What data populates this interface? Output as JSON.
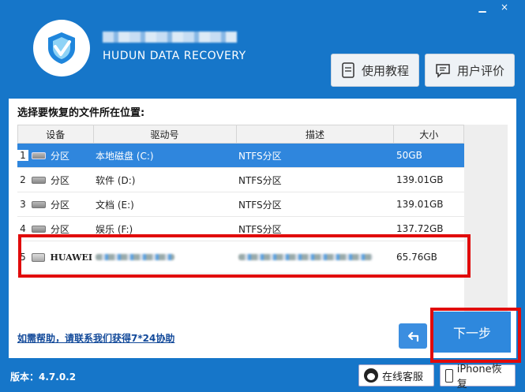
{
  "window": {
    "minimize_icon": "minimize-icon",
    "close_label": "×"
  },
  "brand": {
    "name": "HUDUN DATA RECOVERY"
  },
  "header_buttons": [
    {
      "label": "使用教程",
      "icon": "book-icon"
    },
    {
      "label": "用户评价",
      "icon": "comment-icon"
    }
  ],
  "panel": {
    "title": "选择要恢复的文件所在位置:"
  },
  "table": {
    "columns": [
      "设备",
      "驱动号",
      "描述",
      "大小"
    ],
    "rows": [
      {
        "num": "1",
        "device": "分区",
        "drive": "本地磁盘 (C:)",
        "desc": "NTFS分区",
        "size": "50GB",
        "selected": true
      },
      {
        "num": "2",
        "device": "分区",
        "drive": "软件 (D:)",
        "desc": "NTFS分区",
        "size": "139.01GB"
      },
      {
        "num": "3",
        "device": "分区",
        "drive": "文档 (E:)",
        "desc": "NTFS分区",
        "size": "139.01GB"
      },
      {
        "num": "4",
        "device": "分区",
        "drive": "娱乐 (F:)",
        "desc": "NTFS分区",
        "size": "137.72GB"
      },
      {
        "num": "5",
        "device": "HUAWEI",
        "drive": "",
        "desc": "",
        "size": "65.76GB"
      }
    ]
  },
  "footer": {
    "help_link": "如需帮助，请联系我们获得7*24协助",
    "next_label": "下一步",
    "back_icon": "back-arrow-icon",
    "version": "版本：4.7.0.2",
    "online_service": "在线客服",
    "iphone_recovery": "iPhone恢复"
  },
  "colors": {
    "background": "#1676c9",
    "selected_row": "#2f86dd",
    "highlight_box": "#e10b0b"
  }
}
